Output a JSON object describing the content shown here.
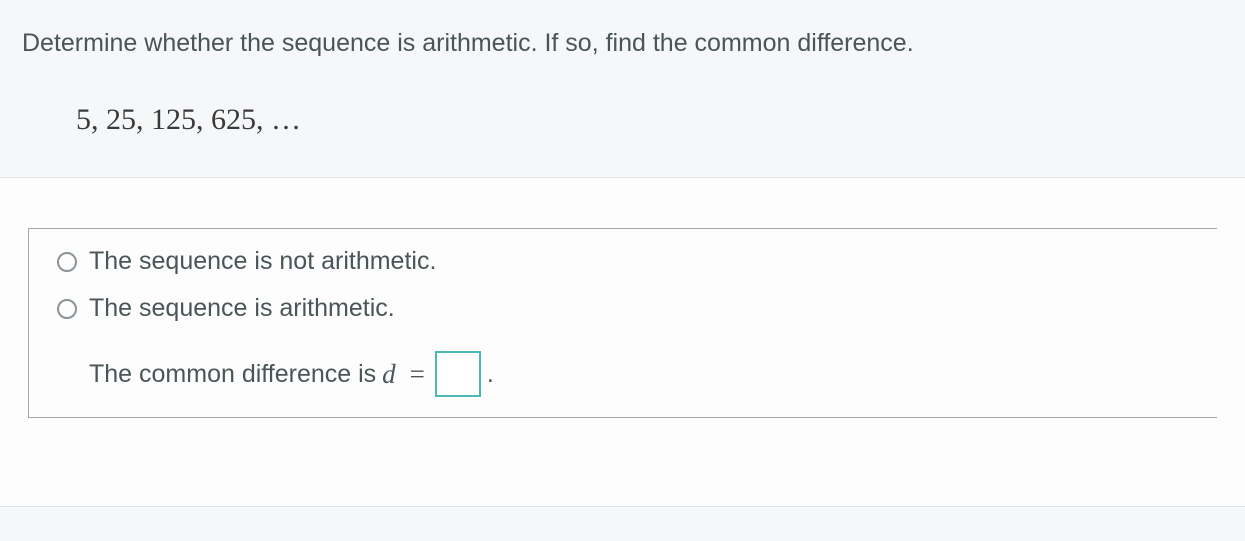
{
  "question": {
    "prompt": "Determine whether the sequence is arithmetic. If so, find the common difference.",
    "sequence": "5, 25, 125, 625, …"
  },
  "options": {
    "not_arithmetic": "The sequence is not arithmetic.",
    "is_arithmetic": "The sequence is arithmetic."
  },
  "difference": {
    "label": "The common difference is ",
    "variable": "d",
    "equals": "=",
    "value": "",
    "period": "."
  }
}
